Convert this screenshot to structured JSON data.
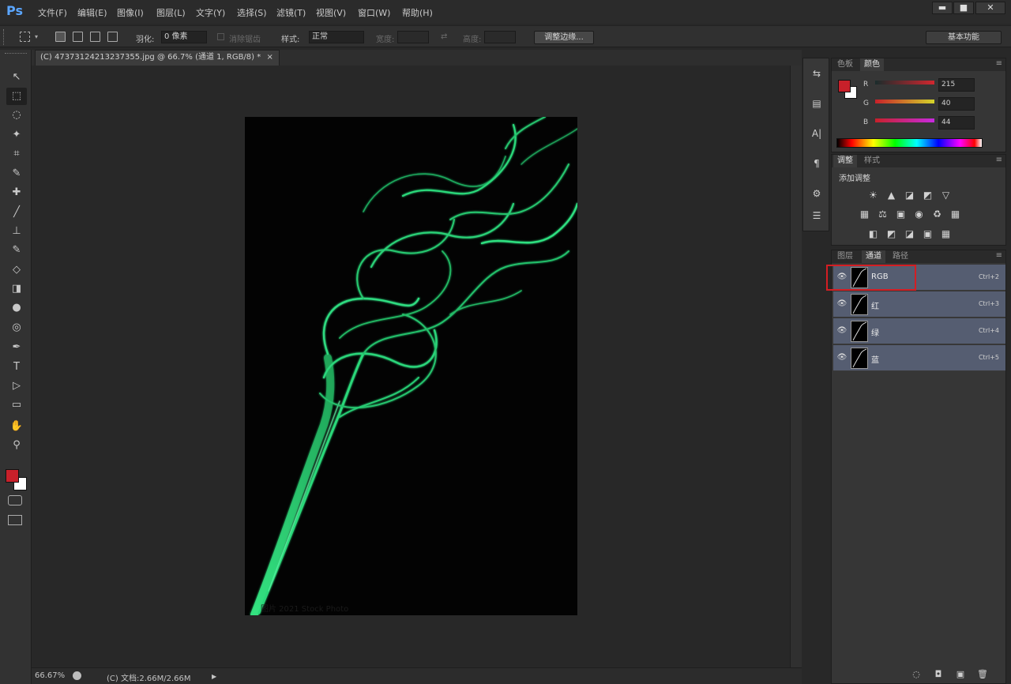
{
  "app": {
    "logo": "Ps"
  },
  "menu": [
    "文件(F)",
    "编辑(E)",
    "图像(I)",
    "图层(L)",
    "文字(Y)",
    "选择(S)",
    "滤镜(T)",
    "视图(V)",
    "窗口(W)",
    "帮助(H)"
  ],
  "window_controls": {
    "minimize": "▬",
    "maximize": "■",
    "close": "✕"
  },
  "options": {
    "feather_label": "羽化:",
    "feather_value": "0 像素",
    "antialias_label": "消除锯齿",
    "style_label": "样式:",
    "style_value": "正常",
    "width_label": "宽度:",
    "height_label": "高度:",
    "refine_button": "调整边缘...",
    "workspace": "基本功能"
  },
  "document": {
    "tab_title": "(C) 47373124213237355.jpg @ 66.7% (通道 1, RGB/8) *",
    "close": "×",
    "watermark": "图片 2021 Stock Photo"
  },
  "status": {
    "zoom": "66.67%",
    "doc_info": "(C) 文档:2.66M/2.66M"
  },
  "colors": {
    "foreground": "#c8202a",
    "background": "#ffffff",
    "smoke": "#2ddc7a",
    "layer_row": "#555d71",
    "highlight": "#d41e23"
  },
  "color_panel": {
    "tabs": [
      "色板",
      "颜色"
    ],
    "active_tab": "颜色",
    "channels": [
      {
        "label": "R",
        "value": "215"
      },
      {
        "label": "G",
        "value": "40"
      },
      {
        "label": "B",
        "value": "44"
      }
    ]
  },
  "adjust_panel": {
    "tabs": [
      "调整",
      "样式"
    ],
    "title": "添加调整",
    "rows": [
      [
        "☀",
        "▲",
        "◪",
        "◩",
        "▽"
      ],
      [
        "▦",
        "⚖",
        "▣",
        "◉",
        "♻",
        "▦"
      ],
      [
        "◧",
        "◩",
        "◪",
        "▣",
        "▦"
      ]
    ]
  },
  "layers_panel": {
    "tabs": [
      "图层",
      "通道",
      "路径"
    ],
    "active_tab": "通道",
    "channels": [
      {
        "name": "RGB",
        "shortcut": "Ctrl+2"
      },
      {
        "name": "红",
        "shortcut": "Ctrl+3"
      },
      {
        "name": "绿",
        "shortcut": "Ctrl+4"
      },
      {
        "name": "蓝",
        "shortcut": "Ctrl+5"
      }
    ]
  },
  "tools": [
    "↖",
    "⬚",
    "◌",
    "✦",
    "⌗",
    "✎",
    "✚",
    "╱",
    "⊥",
    "✎",
    "◇",
    "◨",
    "●",
    "◎",
    "✒",
    "T",
    "▷",
    "▭",
    "✋",
    "⚲"
  ],
  "dock_icons": [
    "⇆",
    "▤",
    "A|",
    "¶",
    "⚙",
    "☰"
  ]
}
